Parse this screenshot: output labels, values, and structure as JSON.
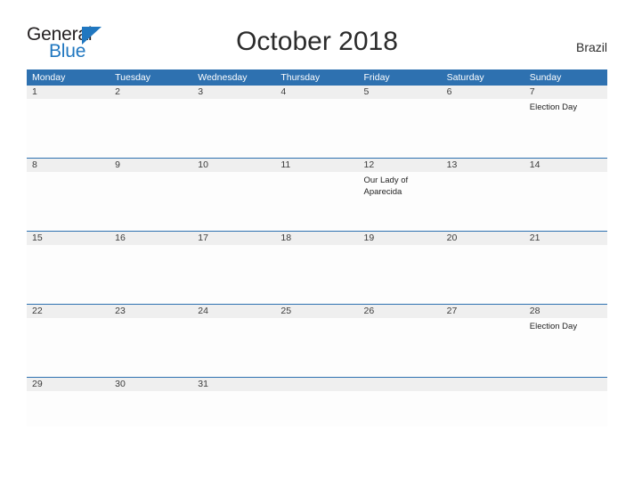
{
  "logo": {
    "word_top": "General",
    "word_bottom": "Blue",
    "accent_color": "#2077c0",
    "flag_icon": "triangle-flag-icon"
  },
  "header": {
    "title": "October 2018",
    "country": "Brazil",
    "header_bg_color": "#2e71b0",
    "band_bg_color": "#efefef"
  },
  "calendar": {
    "weekdays": [
      "Monday",
      "Tuesday",
      "Wednesday",
      "Thursday",
      "Friday",
      "Saturday",
      "Sunday"
    ],
    "weeks": [
      {
        "days": [
          {
            "num": "1",
            "event": ""
          },
          {
            "num": "2",
            "event": ""
          },
          {
            "num": "3",
            "event": ""
          },
          {
            "num": "4",
            "event": ""
          },
          {
            "num": "5",
            "event": ""
          },
          {
            "num": "6",
            "event": ""
          },
          {
            "num": "7",
            "event": "Election Day"
          }
        ]
      },
      {
        "days": [
          {
            "num": "8",
            "event": ""
          },
          {
            "num": "9",
            "event": ""
          },
          {
            "num": "10",
            "event": ""
          },
          {
            "num": "11",
            "event": ""
          },
          {
            "num": "12",
            "event": "Our Lady of Aparecida"
          },
          {
            "num": "13",
            "event": ""
          },
          {
            "num": "14",
            "event": ""
          }
        ]
      },
      {
        "days": [
          {
            "num": "15",
            "event": ""
          },
          {
            "num": "16",
            "event": ""
          },
          {
            "num": "17",
            "event": ""
          },
          {
            "num": "18",
            "event": ""
          },
          {
            "num": "19",
            "event": ""
          },
          {
            "num": "20",
            "event": ""
          },
          {
            "num": "21",
            "event": ""
          }
        ]
      },
      {
        "days": [
          {
            "num": "22",
            "event": ""
          },
          {
            "num": "23",
            "event": ""
          },
          {
            "num": "24",
            "event": ""
          },
          {
            "num": "25",
            "event": ""
          },
          {
            "num": "26",
            "event": ""
          },
          {
            "num": "27",
            "event": ""
          },
          {
            "num": "28",
            "event": "Election Day"
          }
        ]
      },
      {
        "days": [
          {
            "num": "29",
            "event": ""
          },
          {
            "num": "30",
            "event": ""
          },
          {
            "num": "31",
            "event": ""
          },
          {
            "num": "",
            "event": ""
          },
          {
            "num": "",
            "event": ""
          },
          {
            "num": "",
            "event": ""
          },
          {
            "num": "",
            "event": ""
          }
        ]
      }
    ]
  }
}
